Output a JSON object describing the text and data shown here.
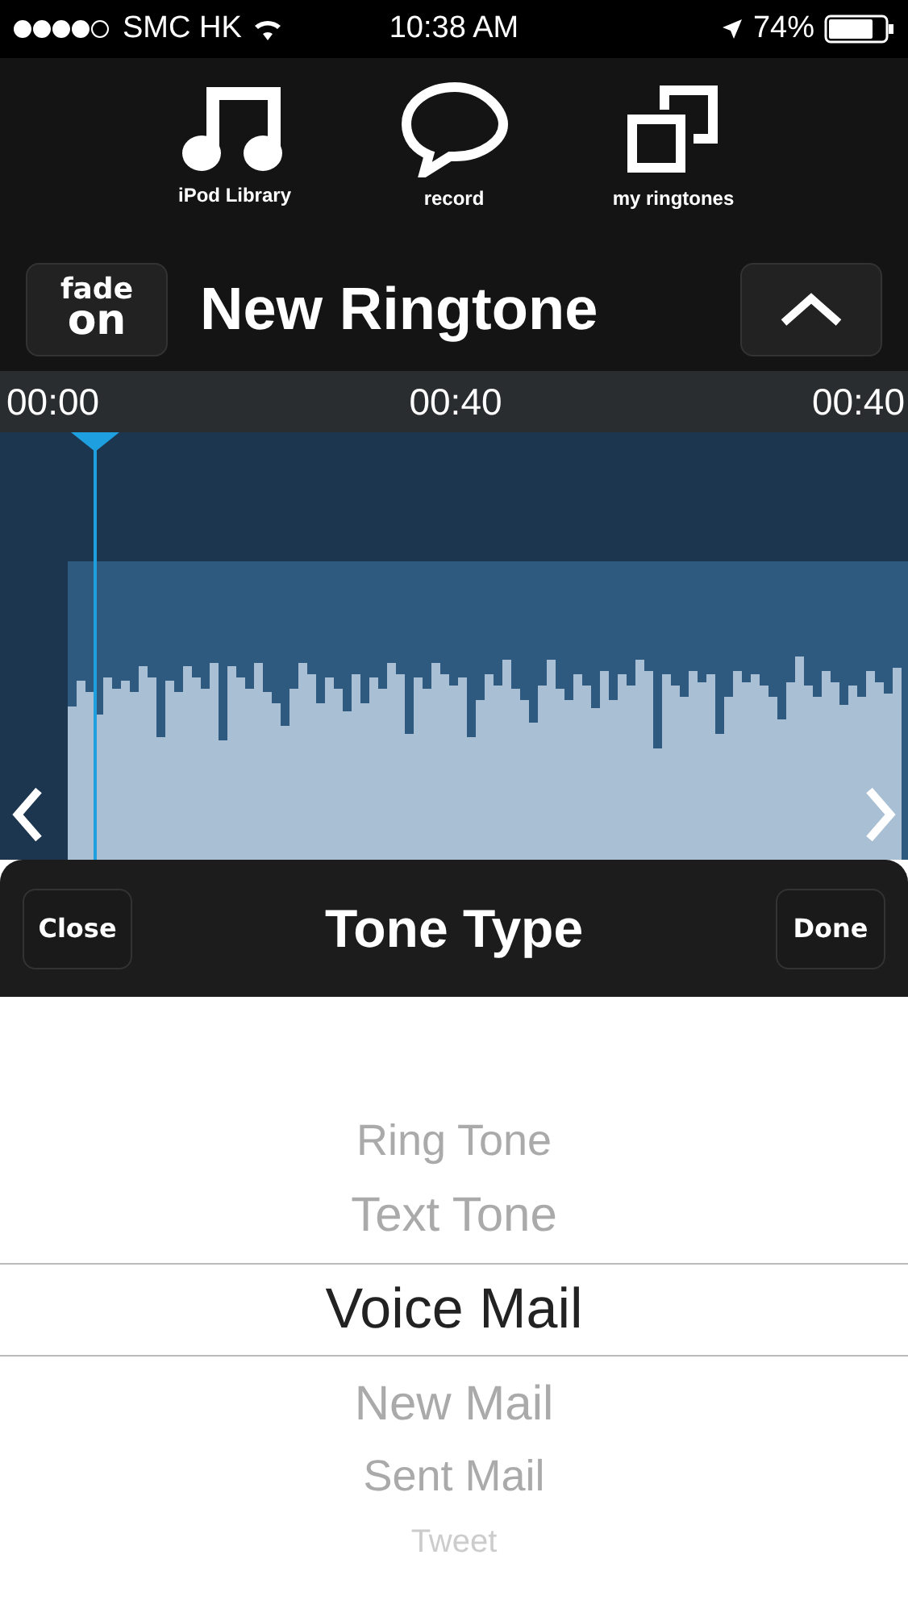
{
  "status_bar": {
    "carrier": "SMC HK",
    "time": "10:38 AM",
    "battery": "74%"
  },
  "toolbar": [
    {
      "kind": "music",
      "label": "iPod Library"
    },
    {
      "kind": "bubble",
      "label": "record"
    },
    {
      "kind": "windows",
      "label": "my ringtones"
    }
  ],
  "header": {
    "fade_top": "fade",
    "fade_bottom": "on",
    "title": "New Ringtone"
  },
  "timeline": {
    "ticks": [
      "00:00",
      "00:40",
      "00:40"
    ]
  },
  "tone_sheet": {
    "close": "Close",
    "title": "Tone Type",
    "done": "Done"
  },
  "picker": [
    {
      "label": "Ring Tone",
      "selected": false
    },
    {
      "label": "Text Tone",
      "selected": false
    },
    {
      "label": "Voice Mail",
      "selected": true
    },
    {
      "label": "New Mail",
      "selected": false
    },
    {
      "label": "Sent Mail",
      "selected": false
    },
    {
      "label": "Tweet",
      "selected": false
    }
  ]
}
